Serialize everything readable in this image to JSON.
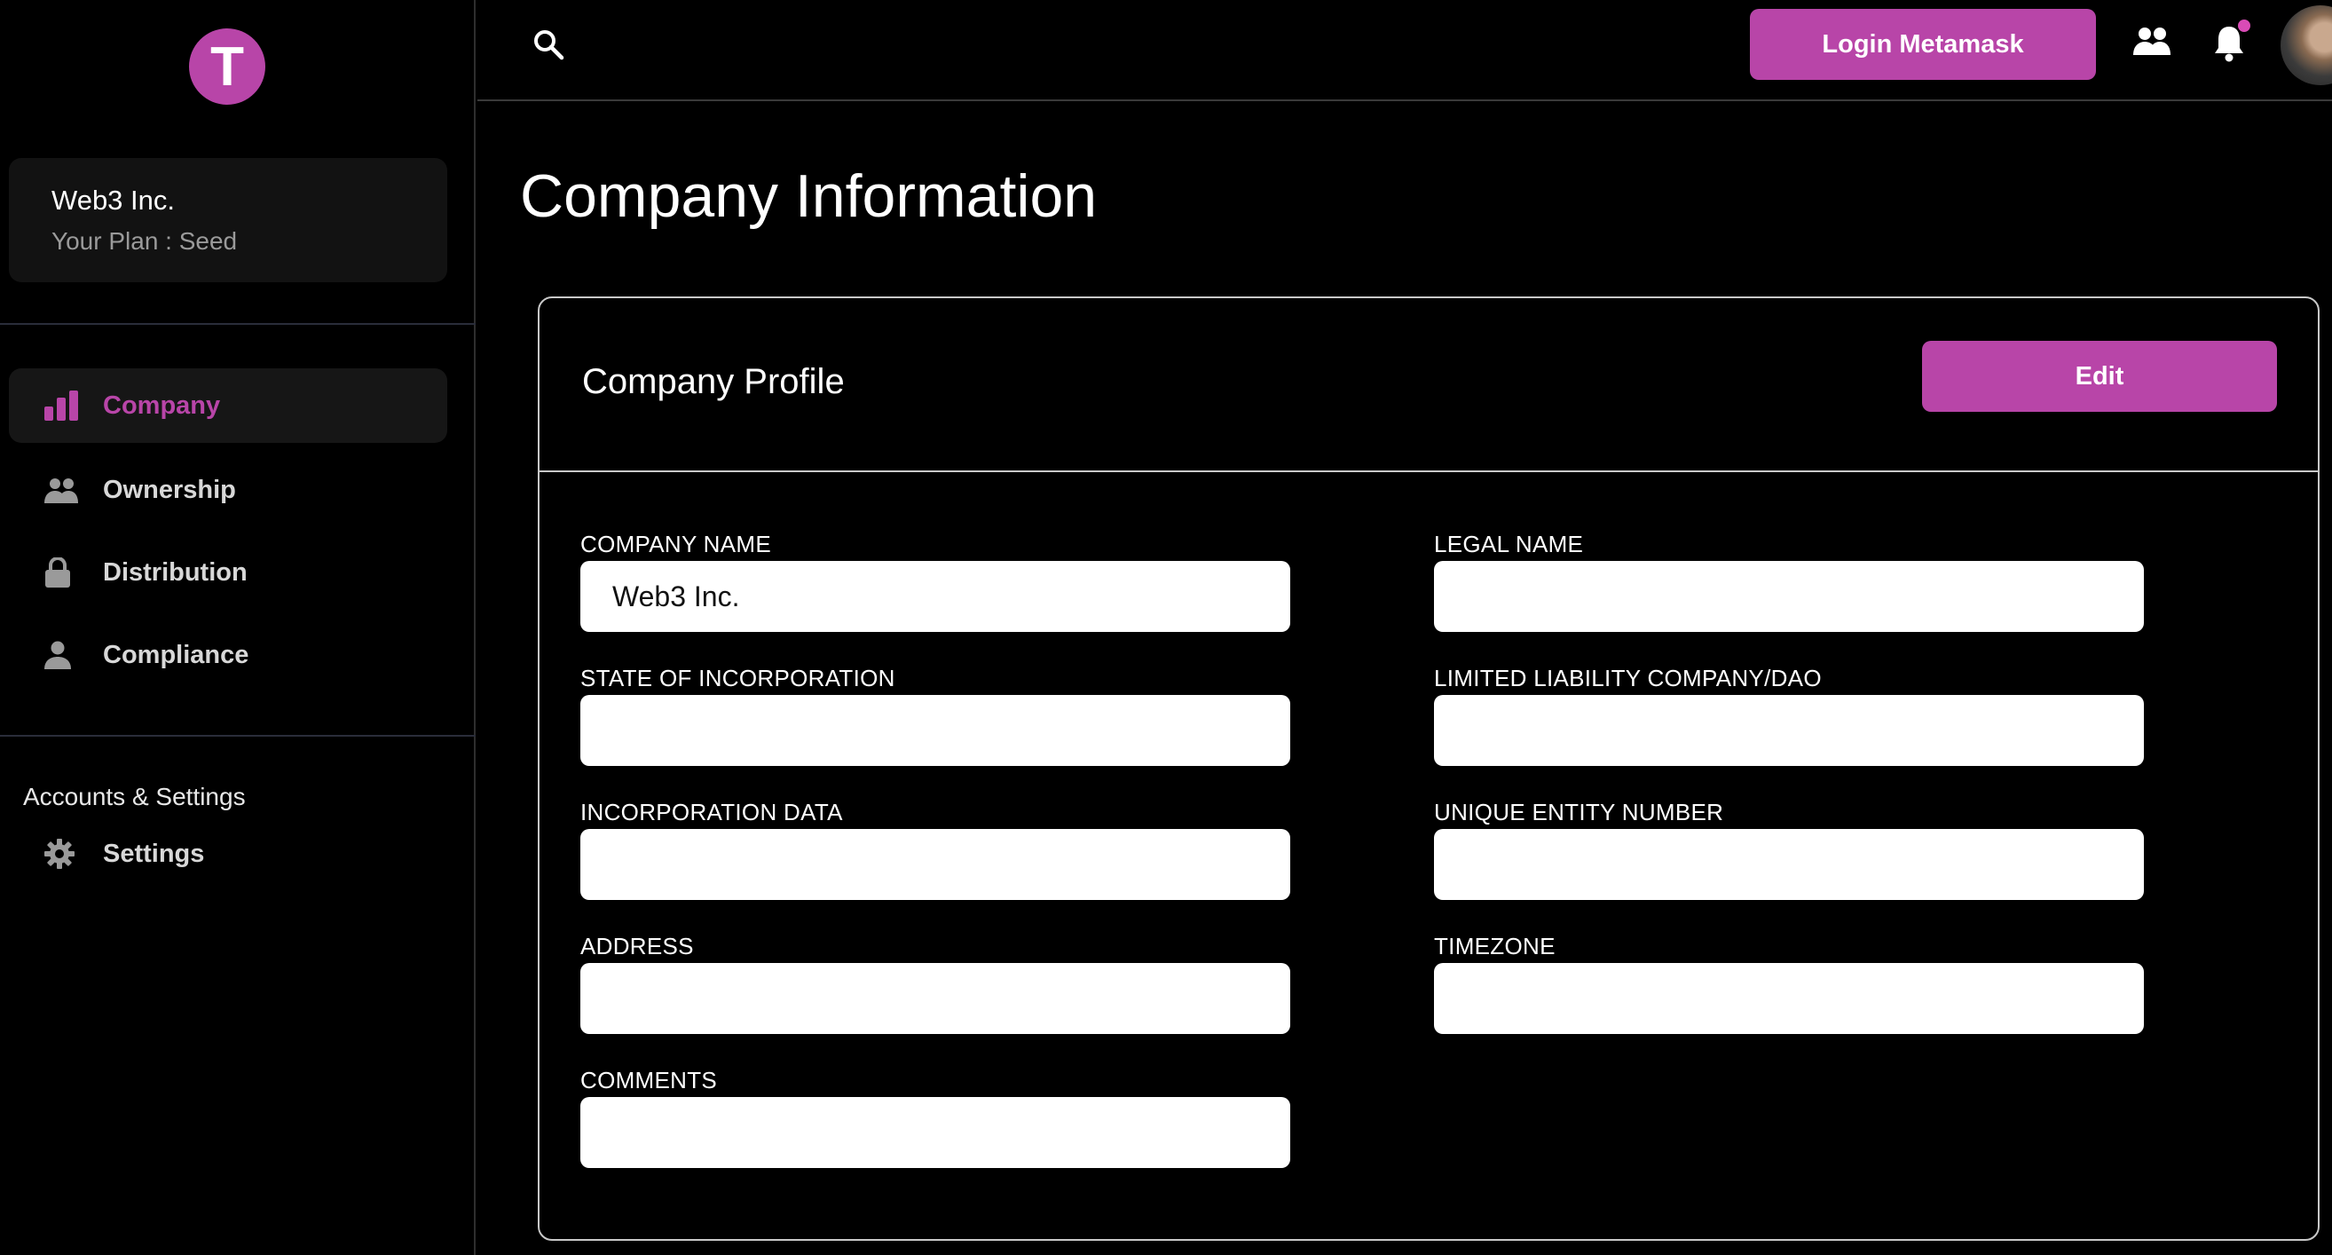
{
  "brand": {
    "logo_letter": "T"
  },
  "account": {
    "company": "Web3 Inc.",
    "plan": "Your Plan : Seed"
  },
  "sidebar": {
    "items": [
      {
        "label": "Company",
        "icon": "bar-chart-icon",
        "active": true
      },
      {
        "label": "Ownership",
        "icon": "people-icon",
        "active": false
      },
      {
        "label": "Distribution",
        "icon": "lock-icon",
        "active": false
      },
      {
        "label": "Compliance",
        "icon": "person-icon",
        "active": false
      }
    ],
    "section_title": "Accounts & Settings",
    "settings": {
      "label": "Settings",
      "icon": "gear-icon"
    }
  },
  "topbar": {
    "login_label": "Login Metamask",
    "icons": [
      "search-icon",
      "team-icon",
      "bell-icon",
      "avatar"
    ]
  },
  "page": {
    "title": "Company Information"
  },
  "card": {
    "title": "Company Profile",
    "edit_label": "Edit",
    "fields": {
      "company_name": {
        "label": "COMPANY NAME",
        "value": "Web3 Inc."
      },
      "legal_name": {
        "label": "LEGAL NAME",
        "value": ""
      },
      "state": {
        "label": "STATE OF INCORPORATION",
        "value": ""
      },
      "llc": {
        "label": "LIMITED LIABILITY COMPANY/DAO",
        "value": ""
      },
      "incorporation_date": {
        "label": "INCORPORATION DATA",
        "value": ""
      },
      "entity_number": {
        "label": "UNIQUE ENTITY NUMBER",
        "value": ""
      },
      "address": {
        "label": "ADDRESS",
        "value": ""
      },
      "timezone": {
        "label": "TIMEZONE",
        "value": ""
      },
      "comments": {
        "label": "COMMENTS",
        "value": ""
      }
    }
  },
  "colors": {
    "accent": "#b845a8",
    "background": "#000000",
    "card_border": "#c8c8c8"
  }
}
